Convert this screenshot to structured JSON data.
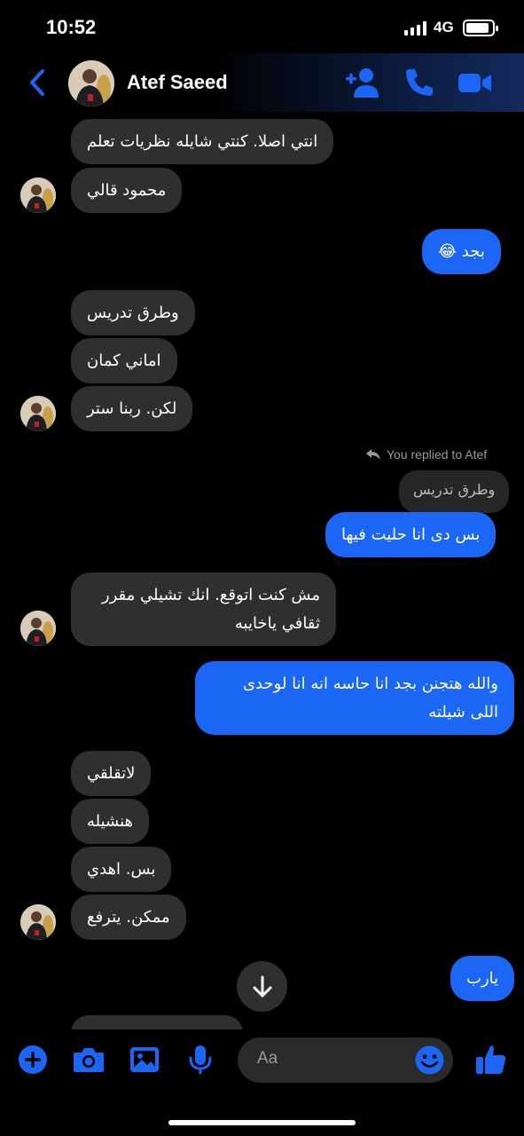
{
  "status": {
    "time": "10:52",
    "network": "4G",
    "battery_level": 0.9
  },
  "header": {
    "name": "Atef Saeed",
    "icons": [
      "back-chevron-icon",
      "add-person-icon",
      "phone-icon",
      "video-camera-icon"
    ]
  },
  "messages": {
    "m1": "انتي اصلا. كنتي شايله نظريات تعلم",
    "m2": "محمود قالي",
    "m3": "بجد 😂",
    "m4": "وطرق تدريس",
    "m5": "اماني كمان",
    "m6": "لكن. ربنا ستر",
    "reply_note": "You replied to Atef",
    "reply_quote": "وطرق تدريس",
    "m7": "بس دى انا حليت فيها",
    "m8": "مش كنت اتوقع. انك تشيلي مقرر ثقافي ياخايبه",
    "m9": "والله هتجنن بجد انا حاسه انه انا لوحدى اللى شيلته",
    "m10": "لاتقلقي",
    "m11": "هنشيله",
    "m12": "بس. اهدي",
    "m13": "ممكن. يترفع",
    "m14": "يارب"
  },
  "composer": {
    "placeholder": "Aa",
    "icons": [
      "plus-icon",
      "camera-icon",
      "gallery-icon",
      "microphone-icon",
      "emoji-icon",
      "thumbs-up-icon"
    ]
  },
  "colors": {
    "accent": "#1b66f5",
    "incoming_bubble": "#2f2f2f",
    "background": "#000000"
  }
}
